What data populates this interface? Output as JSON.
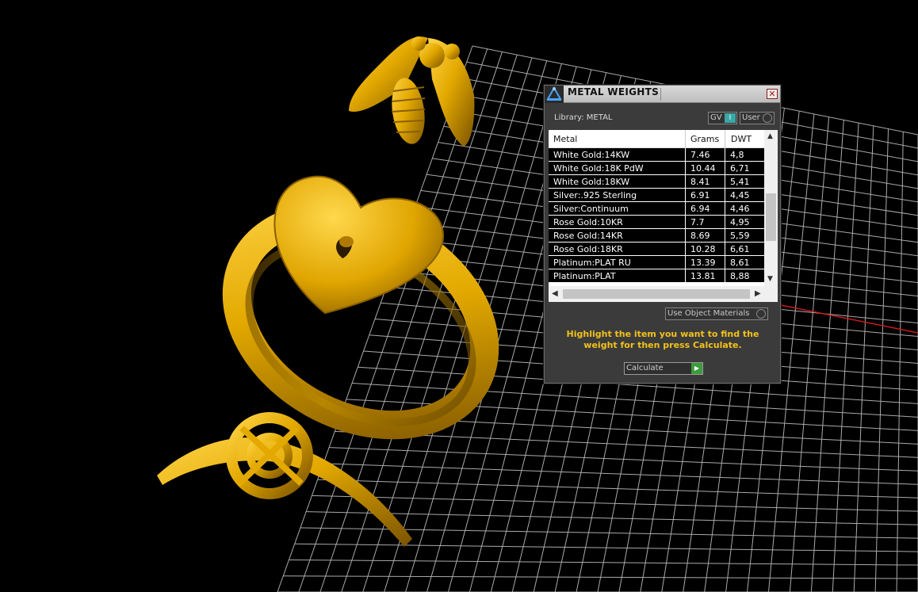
{
  "panel": {
    "title": "METAL WEIGHTS",
    "close_glyph": "✕",
    "library_label": "Library: METAL",
    "gv_label": "GV",
    "gv_indicator": "I",
    "user_label": "User",
    "table": {
      "headers": {
        "metal": "Metal",
        "grams": "Grams",
        "dwt": "DWT"
      },
      "rows": [
        {
          "metal": "White Gold:14KW",
          "grams": "7.46",
          "dwt": "4,8"
        },
        {
          "metal": "White Gold:18K PdW",
          "grams": "10.44",
          "dwt": "6,71"
        },
        {
          "metal": "White Gold:18KW",
          "grams": "8.41",
          "dwt": "5,41"
        },
        {
          "metal": "Silver:.925 Sterling",
          "grams": "6.91",
          "dwt": "4,45"
        },
        {
          "metal": "Silver:Continuum",
          "grams": "6.94",
          "dwt": "4,46"
        },
        {
          "metal": "Rose Gold:10KR",
          "grams": "7.7",
          "dwt": "4,95"
        },
        {
          "metal": "Rose Gold:14KR",
          "grams": "8.69",
          "dwt": "5,59"
        },
        {
          "metal": "Rose Gold:18KR",
          "grams": "10.28",
          "dwt": "6,61"
        },
        {
          "metal": "Platinum:PLAT RU",
          "grams": "13.39",
          "dwt": "8,61"
        },
        {
          "metal": "Platinum:PLAT",
          "grams": "13.81",
          "dwt": "8,88"
        }
      ]
    },
    "use_object_materials": "Use Object Materials",
    "instruction": "Highlight the item you want to find the weight for then press Calculate.",
    "calculate_label": "Calculate"
  },
  "colors": {
    "gold": "#e3a900",
    "instruction_text": "#f2c21a",
    "grid_line": "#c8c8c8",
    "axis_red": "#cc1b1b"
  }
}
